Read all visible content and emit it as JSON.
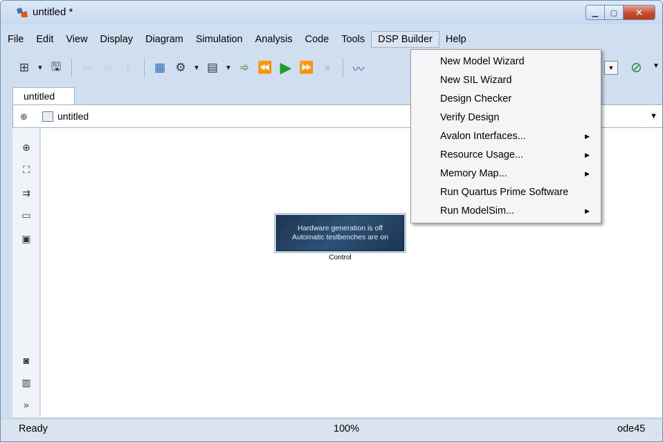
{
  "window": {
    "title": "untitled *"
  },
  "menubar": {
    "items": [
      {
        "label": "File"
      },
      {
        "label": "Edit"
      },
      {
        "label": "View"
      },
      {
        "label": "Display"
      },
      {
        "label": "Diagram"
      },
      {
        "label": "Simulation"
      },
      {
        "label": "Analysis"
      },
      {
        "label": "Code"
      },
      {
        "label": "Tools"
      },
      {
        "label": "DSP Builder"
      },
      {
        "label": "Help"
      }
    ],
    "active": "DSP Builder"
  },
  "tab": {
    "label": "untitled"
  },
  "address": {
    "path": "untitled"
  },
  "block": {
    "line1": "Hardware generation is off",
    "line2": "Automatic testbenches are on",
    "label": "Control"
  },
  "status": {
    "left": "Ready",
    "zoom": "100%",
    "solver": "ode45"
  },
  "dropdown": {
    "items": [
      {
        "label": "New Model Wizard",
        "submenu": false
      },
      {
        "label": "New SIL Wizard",
        "submenu": false
      },
      {
        "label": "Design Checker",
        "submenu": false
      },
      {
        "label": "Verify Design",
        "submenu": false
      },
      {
        "label": "Avalon Interfaces...",
        "submenu": true
      },
      {
        "label": "Resource Usage...",
        "submenu": true
      },
      {
        "label": "Memory Map...",
        "submenu": true
      },
      {
        "label": "Run Quartus Prime Software",
        "submenu": false
      },
      {
        "label": "Run ModelSim...",
        "submenu": true
      }
    ]
  },
  "icons": {
    "toolbar": [
      "new-model-icon",
      "save-icon",
      "back-icon",
      "forward-icon",
      "up-icon",
      "library-browser-icon",
      "settings-gear-icon",
      "model-explorer-icon",
      "step-back-icon",
      "run-icon",
      "step-forward-icon",
      "stop-icon",
      "scope-icon"
    ],
    "palette": [
      "zoom-icon",
      "fit-view-icon",
      "arrow-route-icon",
      "annotation-icon",
      "image-icon",
      "camera-icon",
      "model-browser-icon",
      "expand-icon"
    ]
  }
}
